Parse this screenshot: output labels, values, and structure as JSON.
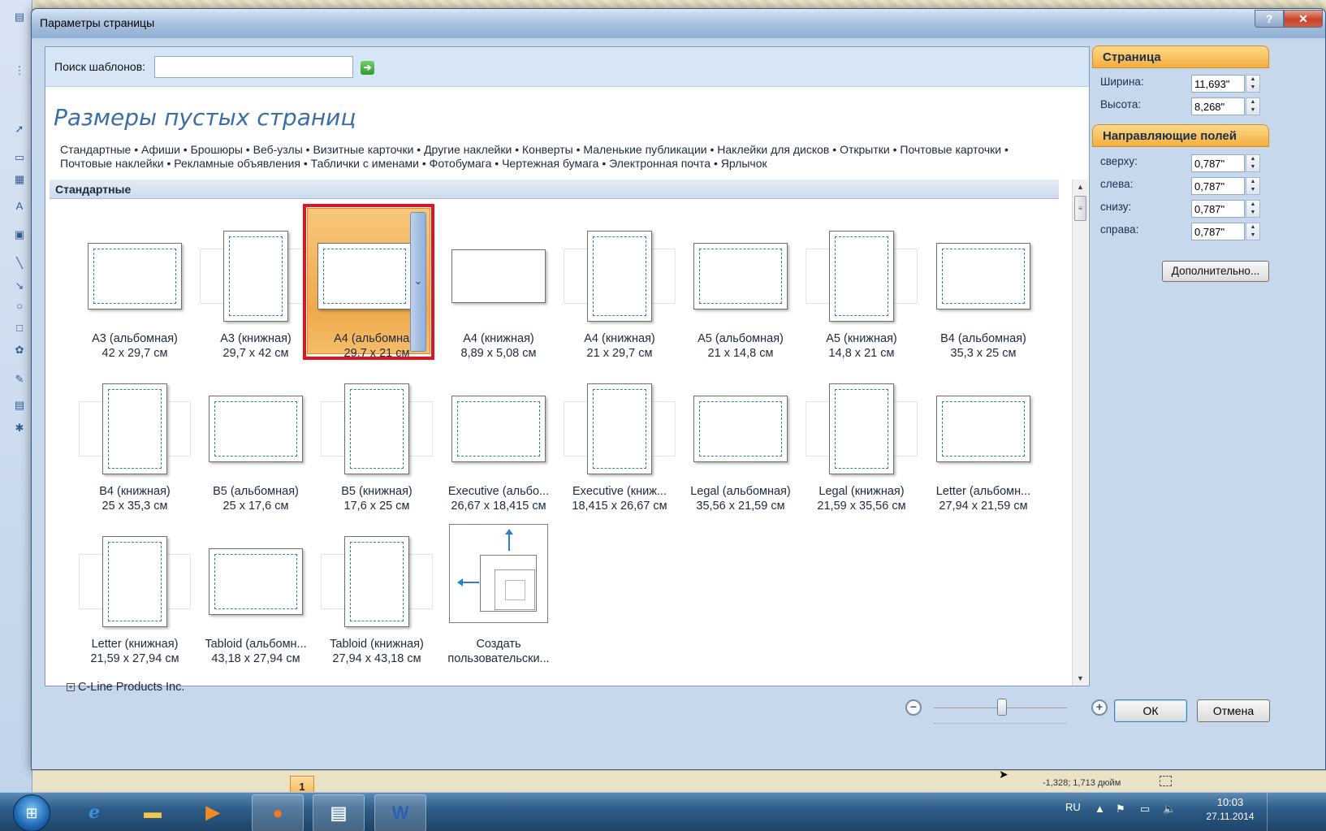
{
  "dialog": {
    "title": "Параметры страницы",
    "help_label": "?",
    "close_label": "✕"
  },
  "search": {
    "label": "Поиск шаблонов:",
    "value": "",
    "go_label": "➔"
  },
  "heading": "Размеры пустых страниц",
  "categories": [
    "Стандартные",
    "Афиши",
    "Брошюры",
    "Веб-узлы",
    "Визитные карточки",
    "Другие наклейки",
    "Конверты",
    "Маленькие публикации",
    "Наклейки для дисков",
    "Открытки",
    "Почтовые карточки",
    "Почтовые наклейки",
    "Рекламные объявления",
    "Таблички с именами",
    "Фотобумага",
    "Чертежная бумага",
    "Электронная почта",
    "Ярлычок"
  ],
  "section_title": "Стандартные",
  "page_sizes": [
    {
      "name": "A3 (альбомная)",
      "size": "42 x 29,7 см"
    },
    {
      "name": "A3 (книжная)",
      "size": "29,7 x 42 см"
    },
    {
      "name": "A4 (альбомная)",
      "size": "29,7 x 21 см",
      "selected": true
    },
    {
      "name": "A4 (книжная)",
      "size": "8,89 x 5,08 см"
    },
    {
      "name": "A4 (книжная)",
      "size": "21 x 29,7 см"
    },
    {
      "name": "A5 (альбомная)",
      "size": "21 x 14,8 см"
    },
    {
      "name": "A5 (книжная)",
      "size": "14,8 x 21 см"
    },
    {
      "name": "B4 (альбомная)",
      "size": "35,3 x 25 см"
    },
    {
      "name": "B4 (книжная)",
      "size": "25 x 35,3 см"
    },
    {
      "name": "B5 (альбомная)",
      "size": "25 x 17,6 см"
    },
    {
      "name": "B5 (книжная)",
      "size": "17,6 x 25 см"
    },
    {
      "name": "Executive (альбо...",
      "size": "26,67 x 18,415 см"
    },
    {
      "name": "Executive (книж...",
      "size": "18,415 x 26,67 см"
    },
    {
      "name": "Legal (альбомная)",
      "size": "35,56 x 21,59 см"
    },
    {
      "name": "Legal (книжная)",
      "size": "21,59 x 35,56 см"
    },
    {
      "name": "Letter (альбомн...",
      "size": "27,94 x 21,59 см"
    },
    {
      "name": "Letter (книжная)",
      "size": "21,59 x 27,94 см"
    },
    {
      "name": "Tabloid (альбомн...",
      "size": "43,18 x 27,94 см"
    },
    {
      "name": "Tabloid (книжная)",
      "size": "27,94 x 43,18 см"
    }
  ],
  "custom_tile": {
    "line1": "Создать",
    "line2": "пользовательски..."
  },
  "collapsed_group": "C-Line Products Inc.",
  "page_panel": {
    "title": "Страница",
    "width_label": "Ширина:",
    "width_value": "11,693\"",
    "height_label": "Высота:",
    "height_value": "8,268\""
  },
  "margins_panel": {
    "title": "Направляющие полей",
    "top_label": "сверху:",
    "top_value": "0,787\"",
    "left_label": "слева:",
    "left_value": "0,787\"",
    "bottom_label": "снизу:",
    "bottom_value": "0,787\"",
    "right_label": "справа:",
    "right_value": "0,787\""
  },
  "more_button": "Дополнительно...",
  "ok_button": "ОК",
  "cancel_button": "Отмена",
  "status": {
    "position": "-1,328; 1,713 дюйм",
    "page_number": "1"
  },
  "taskbar": {
    "language": "RU",
    "time": "10:03",
    "date": "27.11.2014"
  },
  "colors": {
    "accent_orange": "#f3ae3f",
    "selection_red": "#e3121c",
    "heading_blue": "#3c6ea6"
  }
}
